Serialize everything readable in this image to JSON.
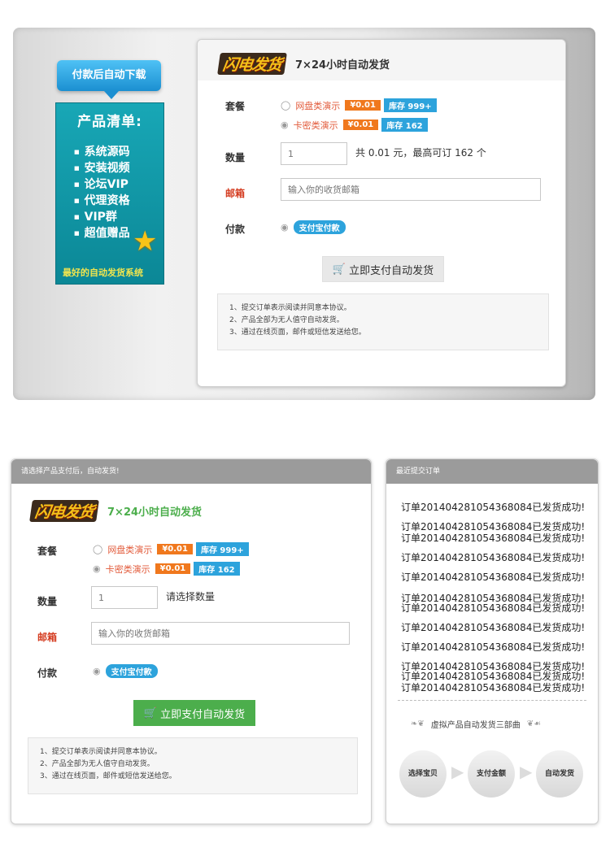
{
  "banner": {
    "bubble_text": "付款后自动下载",
    "product_title": "产品清单:",
    "product_items": [
      "系统源码",
      "安装视频",
      "论坛VIP",
      "代理资格",
      "VIP群",
      "超值赠品"
    ],
    "slogan": "最好的自动发货系统"
  },
  "form_top": {
    "logo_text": "闪电发货",
    "tagline": "7×24小时自动发货",
    "package_label": "套餐",
    "options": [
      {
        "text": "网盘类演示",
        "price": "¥0.01",
        "stock": "库存 999+"
      },
      {
        "text": "卡密类演示",
        "price": "¥0.01",
        "stock": "库存 162"
      }
    ],
    "quantity_label": "数量",
    "quantity_value": "1",
    "quantity_info": "共 0.01 元，最高可订 162 个",
    "email_label": "邮箱",
    "email_placeholder": "输入你的收货邮箱",
    "pay_label": "付款",
    "pay_method": "支付宝付款",
    "submit_label": "立即支付自动发货",
    "notes": [
      "1、提交订单表示阅读并同意本协议。",
      "2、产品全部为无人值守自动发货。",
      "3、通过在线页面，邮件或短信发送给您。"
    ]
  },
  "form_bottom": {
    "header": "请选择产品支付后，自动发货!",
    "logo_text": "闪电发货",
    "tagline": "7×24小时自动发货",
    "package_label": "套餐",
    "options": [
      {
        "text": "网盘类演示",
        "price": "¥0.01",
        "stock": "库存 999+"
      },
      {
        "text": "卡密类演示",
        "price": "¥0.01",
        "stock": "库存 162"
      }
    ],
    "quantity_label": "数量",
    "quantity_value": "1",
    "quantity_info": "请选择数量",
    "email_label": "邮箱",
    "email_placeholder": "输入你的收货邮箱",
    "pay_label": "付款",
    "pay_method": "支付宝付款",
    "submit_label": "立即支付自动发货",
    "notes": [
      "1、提交订单表示阅读并同意本协议。",
      "2、产品全部为无人值守自动发货。",
      "3、通过在线页面，邮件或短信发送给您。"
    ]
  },
  "orders_panel": {
    "header": "最近提交订单",
    "orders": [
      "订单201404281054368084已发货成功!",
      "订单201404281054368084已发货成功!",
      "订单201404281054368084已发货成功!",
      "订单201404281054368084已发货成功!",
      "订单201404281054368084已发货成功!",
      "订单201404281054368084已发货成功!",
      "订单201404281054368084已发货成功!",
      "订单201404281054368084已发货成功!",
      "订单201404281054368084已发货成功!",
      "订单201404281054368084已发货成功!",
      "订单201404281054368084已发货成功!",
      "订单201404281054368084已发货成功!"
    ],
    "steps_title": "虚拟产品自动发货三部曲",
    "steps": [
      "选择宝贝",
      "支付金额",
      "自动发货"
    ]
  },
  "colors": {
    "accent_orange": "#f0781d",
    "accent_blue": "#2da3dc",
    "accent_green": "#4cae4c",
    "label_red": "#d43b1f"
  },
  "icons": {
    "cart": "cart-icon",
    "star": "star-icon",
    "radio": "radio-icon"
  }
}
